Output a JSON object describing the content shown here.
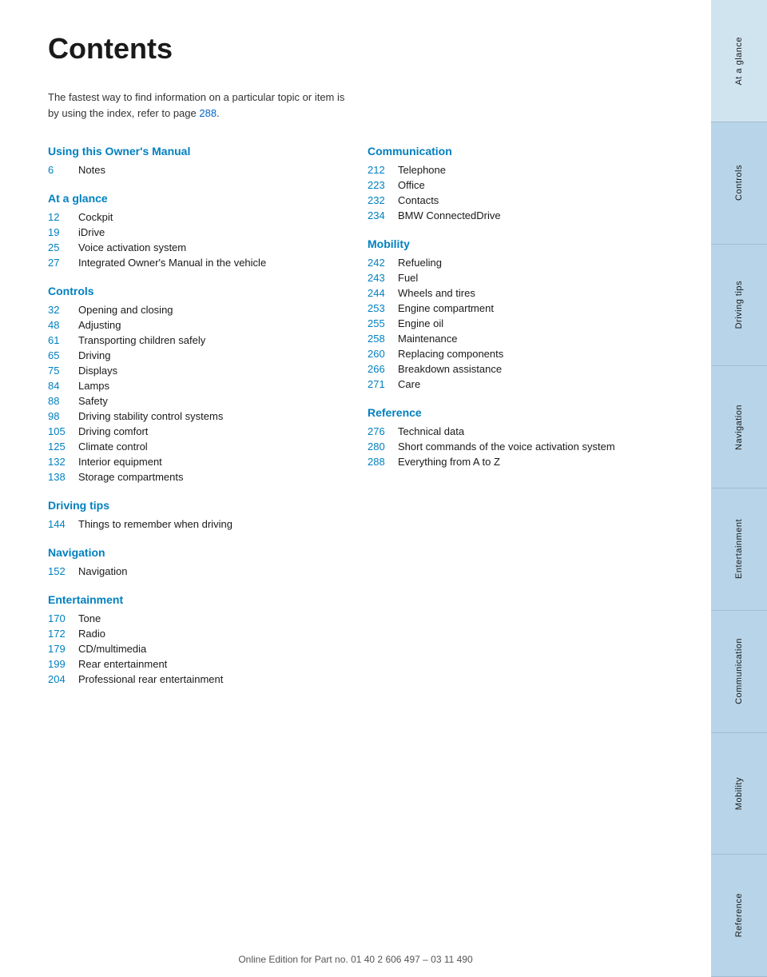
{
  "page": {
    "title": "Contents",
    "intro": "The fastest way to find information on a particular topic or item is by using the index, refer to page ",
    "intro_page": "288",
    "intro_suffix": "."
  },
  "footer": {
    "text": "Online Edition for Part no. 01 40 2 606 497 – 03 11 490"
  },
  "left_column": {
    "sections": [
      {
        "heading": "Using this Owner's Manual",
        "items": [
          {
            "num": "6",
            "label": "Notes"
          }
        ]
      },
      {
        "heading": "At a glance",
        "items": [
          {
            "num": "12",
            "label": "Cockpit"
          },
          {
            "num": "19",
            "label": "iDrive"
          },
          {
            "num": "25",
            "label": "Voice activation system"
          },
          {
            "num": "27",
            "label": "Integrated Owner's Manual in the vehicle"
          }
        ]
      },
      {
        "heading": "Controls",
        "items": [
          {
            "num": "32",
            "label": "Opening and closing"
          },
          {
            "num": "48",
            "label": "Adjusting"
          },
          {
            "num": "61",
            "label": "Transporting children safely"
          },
          {
            "num": "65",
            "label": "Driving"
          },
          {
            "num": "75",
            "label": "Displays"
          },
          {
            "num": "84",
            "label": "Lamps"
          },
          {
            "num": "88",
            "label": "Safety"
          },
          {
            "num": "98",
            "label": "Driving stability control systems"
          },
          {
            "num": "105",
            "label": "Driving comfort"
          },
          {
            "num": "125",
            "label": "Climate control"
          },
          {
            "num": "132",
            "label": "Interior equipment"
          },
          {
            "num": "138",
            "label": "Storage compartments"
          }
        ]
      },
      {
        "heading": "Driving tips",
        "items": [
          {
            "num": "144",
            "label": "Things to remember when driving"
          }
        ]
      },
      {
        "heading": "Navigation",
        "items": [
          {
            "num": "152",
            "label": "Navigation"
          }
        ]
      },
      {
        "heading": "Entertainment",
        "items": [
          {
            "num": "170",
            "label": "Tone"
          },
          {
            "num": "172",
            "label": "Radio"
          },
          {
            "num": "179",
            "label": "CD/multimedia"
          },
          {
            "num": "199",
            "label": "Rear entertainment"
          },
          {
            "num": "204",
            "label": "Professional rear entertainment"
          }
        ]
      }
    ]
  },
  "right_column": {
    "sections": [
      {
        "heading": "Communication",
        "items": [
          {
            "num": "212",
            "label": "Telephone"
          },
          {
            "num": "223",
            "label": "Office"
          },
          {
            "num": "232",
            "label": "Contacts"
          },
          {
            "num": "234",
            "label": "BMW ConnectedDrive"
          }
        ]
      },
      {
        "heading": "Mobility",
        "items": [
          {
            "num": "242",
            "label": "Refueling"
          },
          {
            "num": "243",
            "label": "Fuel"
          },
          {
            "num": "244",
            "label": "Wheels and tires"
          },
          {
            "num": "253",
            "label": "Engine compartment"
          },
          {
            "num": "255",
            "label": "Engine oil"
          },
          {
            "num": "258",
            "label": "Maintenance"
          },
          {
            "num": "260",
            "label": "Replacing components"
          },
          {
            "num": "266",
            "label": "Breakdown assistance"
          },
          {
            "num": "271",
            "label": "Care"
          }
        ]
      },
      {
        "heading": "Reference",
        "items": [
          {
            "num": "276",
            "label": "Technical data"
          },
          {
            "num": "280",
            "label": "Short commands of the voice activation system"
          },
          {
            "num": "288",
            "label": "Everything from A to Z"
          }
        ]
      }
    ]
  },
  "sidebar": {
    "tabs": [
      {
        "label": "At a glance"
      },
      {
        "label": "Controls"
      },
      {
        "label": "Driving tips"
      },
      {
        "label": "Navigation"
      },
      {
        "label": "Entertainment"
      },
      {
        "label": "Communication"
      },
      {
        "label": "Mobility"
      },
      {
        "label": "Reference"
      }
    ]
  }
}
